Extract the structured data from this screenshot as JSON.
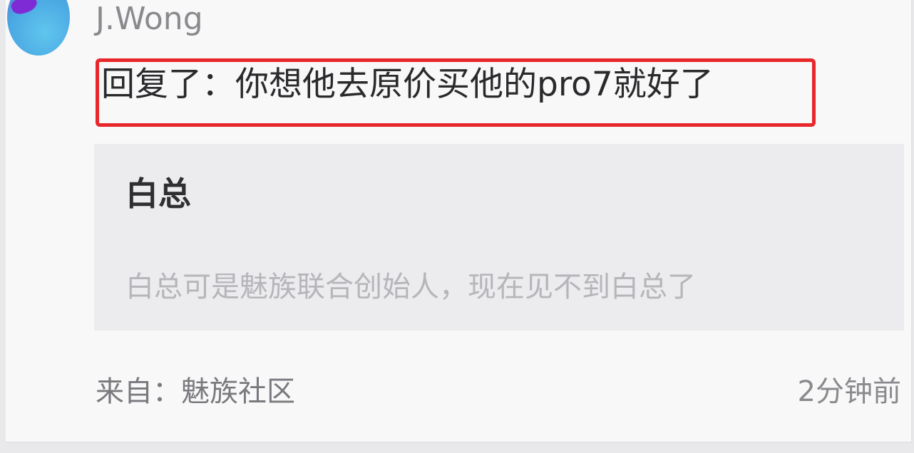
{
  "comment": {
    "username": "J.Wong",
    "reply_text": "回复了：你想他去原价买他的pro7就好了",
    "highlight_color": "#e8272b"
  },
  "quoted": {
    "author": "白总",
    "text": "白总可是魅族联合创始人，现在见不到白总了"
  },
  "footer": {
    "source": "来自：魅族社区",
    "time": "2分钟前"
  }
}
